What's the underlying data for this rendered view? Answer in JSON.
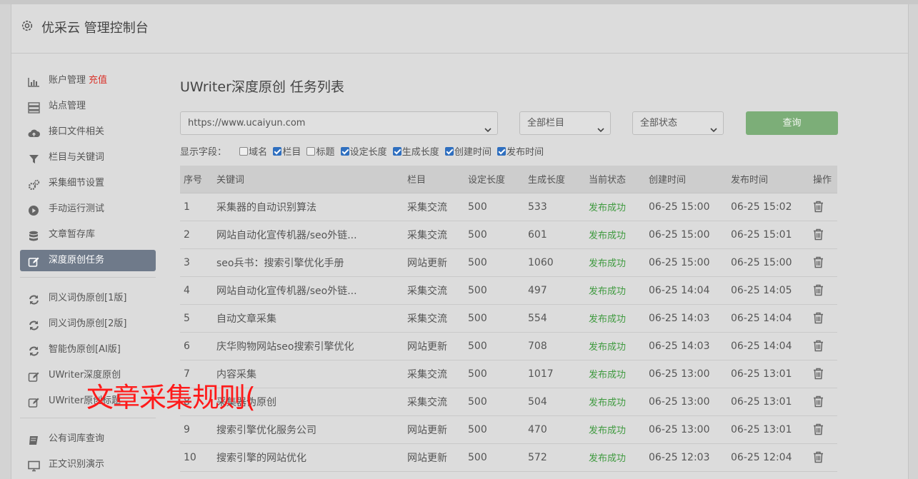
{
  "header": {
    "title": "优采云 管理控制台",
    "icon": "gear-icon"
  },
  "sidebar": {
    "group1": [
      {
        "label": "账户管理",
        "icon": "bar-chart-icon",
        "badge": "充值",
        "badge_color": "#d9342b"
      },
      {
        "label": "站点管理",
        "icon": "server-icon"
      },
      {
        "label": "接口文件相关",
        "icon": "cloud-upload-icon"
      },
      {
        "label": "栏目与关键词",
        "icon": "filter-icon"
      },
      {
        "label": "采集细节设置",
        "icon": "cogs-icon"
      },
      {
        "label": "手动运行测试",
        "icon": "play-circle-icon"
      },
      {
        "label": "文章暂存库",
        "icon": "database-icon"
      },
      {
        "label": "深度原创任务",
        "icon": "edit-icon",
        "active": true
      }
    ],
    "group2": [
      {
        "label": "同义词伪原创[1版]",
        "icon": "refresh-icon"
      },
      {
        "label": "同义词伪原创[2版]",
        "icon": "refresh-icon"
      },
      {
        "label": "智能伪原创[AI版]",
        "icon": "refresh-icon"
      },
      {
        "label": "UWriter深度原创",
        "icon": "edit-icon"
      },
      {
        "label": "UWriter原创标题",
        "icon": "edit-icon"
      }
    ],
    "group3": [
      {
        "label": "公有词库查询",
        "icon": "book-icon"
      },
      {
        "label": "正文识别演示",
        "icon": "monitor-icon"
      }
    ]
  },
  "main": {
    "title": "UWriter深度原创 任务列表",
    "filters": {
      "site": "https://www.ucaiyun.com",
      "column": "全部栏目",
      "status": "全部状态",
      "query_label": "查询"
    },
    "fields_label": "显示字段：",
    "fields": [
      {
        "label": "域名",
        "checked": false
      },
      {
        "label": "栏目",
        "checked": true
      },
      {
        "label": "标题",
        "checked": false
      },
      {
        "label": "设定长度",
        "checked": true
      },
      {
        "label": "生成长度",
        "checked": true
      },
      {
        "label": "创建时间",
        "checked": true
      },
      {
        "label": "发布时间",
        "checked": true
      }
    ],
    "table": {
      "headers": [
        "序号",
        "关键词",
        "栏目",
        "设定长度",
        "生成长度",
        "当前状态",
        "创建时间",
        "发布时间",
        "操作"
      ],
      "rows": [
        [
          "1",
          "采集器的自动识别算法",
          "采集交流",
          "500",
          "533",
          "发布成功",
          "06-25 15:00",
          "06-25 15:02"
        ],
        [
          "2",
          "网站自动化宣传机器/seo外链...",
          "采集交流",
          "500",
          "601",
          "发布成功",
          "06-25 15:00",
          "06-25 15:01"
        ],
        [
          "3",
          "seo兵书：搜索引擎优化手册",
          "网站更新",
          "500",
          "1060",
          "发布成功",
          "06-25 15:00",
          "06-25 15:00"
        ],
        [
          "4",
          "网站自动化宣传机器/seo外链...",
          "采集交流",
          "500",
          "497",
          "发布成功",
          "06-25 14:04",
          "06-25 14:05"
        ],
        [
          "5",
          "自动文章采集",
          "采集交流",
          "500",
          "554",
          "发布成功",
          "06-25 14:03",
          "06-25 14:04"
        ],
        [
          "6",
          "庆华购物网站seo搜索引擎优化",
          "网站更新",
          "500",
          "708",
          "发布成功",
          "06-25 14:03",
          "06-25 14:04"
        ],
        [
          "7",
          "内容采集",
          "采集交流",
          "500",
          "1017",
          "发布成功",
          "06-25 13:00",
          "06-25 13:01"
        ],
        [
          "8",
          "采集器伪原创",
          "采集交流",
          "500",
          "504",
          "发布成功",
          "06-25 13:00",
          "06-25 13:01"
        ],
        [
          "9",
          "搜索引擎优化服务公司",
          "网站更新",
          "500",
          "470",
          "发布成功",
          "06-25 13:00",
          "06-25 13:01"
        ],
        [
          "10",
          "搜索引擎的网站优化",
          "网站更新",
          "500",
          "572",
          "发布成功",
          "06-25 12:03",
          "06-25 12:04"
        ]
      ]
    }
  },
  "overlay": {
    "text": "文章采集规则(",
    "color": "#ff1a1a"
  }
}
